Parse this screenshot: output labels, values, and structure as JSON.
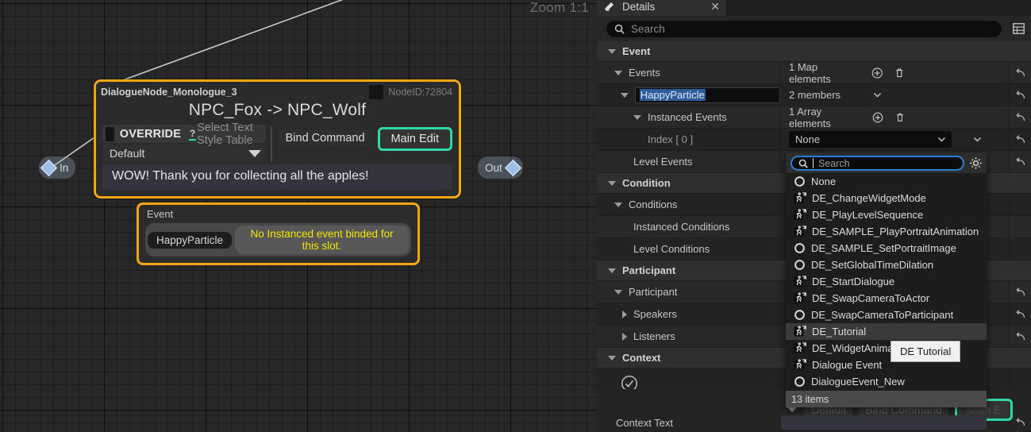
{
  "graph": {
    "zoom_label": "Zoom 1:1",
    "pins": {
      "in_label": "In",
      "out_label": "Out"
    },
    "dialogue_node": {
      "name": "DialogueNode_Monologue_3",
      "node_id": "NodeID:72804",
      "heading": "NPC_Fox -> NPC_Wolf",
      "override_label": "OVERRIDE",
      "style_table_label": "Select Text Style Table",
      "style_value": "Default",
      "bind_command_label": "Bind Command",
      "main_edit_label": "Main Edit",
      "dialogue_text": "WOW! Thank you for collecting all the apples!"
    },
    "event_node": {
      "title": "Event",
      "chip": "HappyParticle",
      "warning": "No Instanced event binded for this slot."
    }
  },
  "details": {
    "tab_label": "Details",
    "search_placeholder": "Search",
    "sections": [
      {
        "kind": "category",
        "label": "Event"
      },
      {
        "kind": "prop",
        "label": "Events",
        "value": "1 Map elements",
        "indent": 1,
        "expander": "down",
        "has_add": true,
        "has_delete": true,
        "has_reset": true
      },
      {
        "kind": "prop",
        "label": "HappyParticle",
        "value": "2 members",
        "indent": 2,
        "expander": "down",
        "field": true,
        "has_chevron": true,
        "has_reset": true
      },
      {
        "kind": "prop",
        "label": "Instanced Events",
        "value": "1 Array elements",
        "indent": 3,
        "expander": "down",
        "has_add": true,
        "has_delete": true,
        "has_reset": true
      },
      {
        "kind": "prop",
        "label": "Index [ 0 ]",
        "value": "None",
        "indent": 4,
        "combo": true,
        "has_chevron": true,
        "has_reset": true
      },
      {
        "kind": "prop",
        "label": "Level Events",
        "value": "",
        "indent": 3,
        "has_reset": true
      },
      {
        "kind": "category",
        "label": "Condition"
      },
      {
        "kind": "prop",
        "label": "Conditions",
        "value": "",
        "indent": 1,
        "expander": "down"
      },
      {
        "kind": "prop",
        "label": "Instanced Conditions",
        "value": "",
        "indent": 3
      },
      {
        "kind": "prop",
        "label": "Level Conditions",
        "value": "",
        "indent": 3
      },
      {
        "kind": "category",
        "label": "Participant"
      },
      {
        "kind": "prop",
        "label": "Participant",
        "value": "",
        "indent": 1,
        "expander": "down",
        "has_reset": true
      },
      {
        "kind": "prop",
        "label": "Speakers",
        "value": "",
        "indent": 2,
        "expander": "right",
        "has_reset": true
      },
      {
        "kind": "prop",
        "label": "Listeners",
        "value": "",
        "indent": 2,
        "expander": "right",
        "has_reset": true
      },
      {
        "kind": "category",
        "label": "Context"
      },
      {
        "kind": "prop",
        "label": "",
        "value": "",
        "indent": 1,
        "check": true
      }
    ],
    "context_text_label": "Context Text"
  },
  "dropdown": {
    "search_placeholder": "Search",
    "items": [
      {
        "label": "None",
        "icon": "circle-icon"
      },
      {
        "label": "DE_ChangeWidgetMode",
        "icon": "blueprint-icon"
      },
      {
        "label": "DE_PlayLevelSequence",
        "icon": "blueprint-icon"
      },
      {
        "label": "DE_SAMPLE_PlayPortraitAnimation",
        "icon": "blueprint-icon"
      },
      {
        "label": "DE_SAMPLE_SetPortraitImage",
        "icon": "circle-icon"
      },
      {
        "label": "DE_SetGlobalTimeDilation",
        "icon": "circle-icon"
      },
      {
        "label": "DE_StartDialogue",
        "icon": "blueprint-icon"
      },
      {
        "label": "DE_SwapCameraToActor",
        "icon": "blueprint-icon"
      },
      {
        "label": "DE_SwapCameraToParticipant",
        "icon": "circle-icon"
      },
      {
        "label": "DE_Tutorial",
        "icon": "blueprint-icon",
        "hover": true
      },
      {
        "label": "DE_WidgetAnimation",
        "icon": "blueprint-icon"
      },
      {
        "label": "Dialogue Event",
        "icon": "blueprint-icon"
      },
      {
        "label": "DialogueEvent_New",
        "icon": "circle-icon"
      }
    ],
    "footer": "13 items",
    "tooltip": "DE Tutorial"
  },
  "bottom_partial": {
    "ghost_default": "Default",
    "ghost_bind": "Bind Command",
    "ghost_main": "Main E"
  },
  "colors": {
    "node_border": "#f2a712",
    "accent_teal": "#2fd6a8",
    "warning_yellow": "#f3e400",
    "selection_blue": "#2e5c9a",
    "focus_blue": "#2a7fd4"
  }
}
